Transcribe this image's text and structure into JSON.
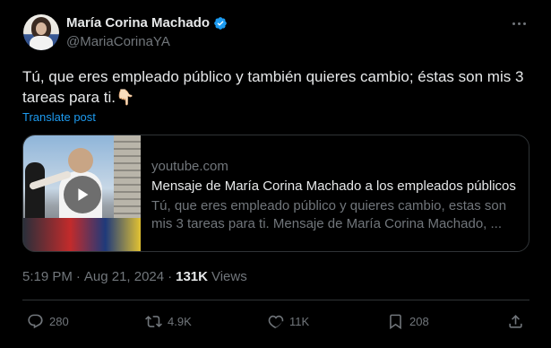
{
  "author": {
    "display_name": "María Corina Machado",
    "handle": "@MariaCorinaYA",
    "verified": true
  },
  "tweet": {
    "text": "Tú, que eres empleado público y también quieres cambio; éstas son mis 3 tareas para ti.👇🏻",
    "translate_label": "Translate post"
  },
  "card": {
    "domain": "youtube.com",
    "title": "Mensaje de María Corina Machado a los empleados públicos",
    "description": "Tú, que eres empleado público y quieres cambio, estas son mis 3 tareas para ti. Mensaje de María Corina Machado, ..."
  },
  "meta": {
    "time": "5:19 PM",
    "separator": "·",
    "date": "Aug 21, 2024",
    "separator2": "·",
    "views_count": "131K",
    "views_label": "Views"
  },
  "actions": {
    "replies": "280",
    "reposts": "4.9K",
    "likes": "11K",
    "bookmarks": "208"
  },
  "colors": {
    "background": "#000000",
    "text": "#e7e9ea",
    "muted": "#71767b",
    "accent": "#1d9bf0",
    "border": "#2f3336"
  },
  "icons": {
    "verified": "verified-badge-icon",
    "more": "more-icon",
    "reply": "reply-icon",
    "repost": "repost-icon",
    "like": "heart-icon",
    "bookmark": "bookmark-icon",
    "share": "share-icon",
    "play": "play-icon"
  }
}
